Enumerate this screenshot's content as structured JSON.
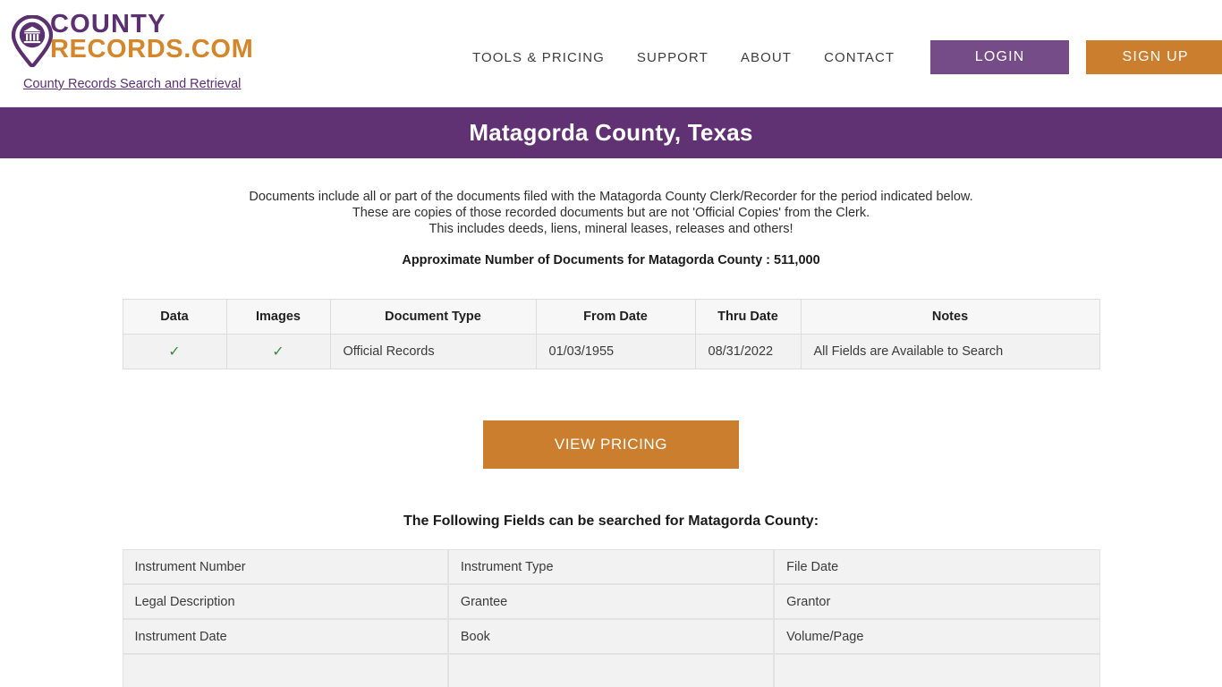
{
  "header": {
    "logo": {
      "icon": "courthouse-map-pin-icon",
      "line1": "COUNTY",
      "line2": "RECORDS.COM",
      "tagline": "County Records Search and Retrieval"
    },
    "nav_links": [
      {
        "label": "TOOLS & PRICING",
        "name": "nav-link-tools-pricing"
      },
      {
        "label": "SUPPORT",
        "name": "nav-link-support"
      },
      {
        "label": "ABOUT",
        "name": "nav-link-about"
      },
      {
        "label": "CONTACT",
        "name": "nav-link-contact"
      }
    ],
    "login_label": "LOGIN",
    "signup_label": "SIGN UP"
  },
  "banner": {
    "title": "Matagorda County, Texas"
  },
  "intro": {
    "line1": "Documents include all or part of the documents filed with the Matagorda County Clerk/Recorder for the period indicated below.",
    "line2": "These are copies of those recorded documents but are not 'Official Copies' from the Clerk.",
    "line3": "This includes deeds, liens, mineral leases, releases and others!",
    "doc_count": "Approximate Number of Documents for Matagorda County : 511,000"
  },
  "coverage_table": {
    "headers": [
      "Data",
      "Images",
      "Document Type",
      "From Date",
      "Thru Date",
      "Notes"
    ],
    "rows": [
      {
        "data": "✓",
        "images": "✓",
        "document_type": "Official Records",
        "from_date": "01/03/1955",
        "thru_date": "08/31/2022",
        "notes": "All Fields are Available to Search"
      }
    ]
  },
  "pricing": {
    "button_label": "VIEW PRICING"
  },
  "fields_section": {
    "heading": "The Following Fields can be searched for Matagorda County:",
    "rows": [
      [
        "Instrument Number",
        "Instrument Type",
        "File Date"
      ],
      [
        "Legal Description",
        "Grantee",
        "Grantor"
      ],
      [
        "Instrument Date",
        "Book",
        "Volume/Page"
      ],
      [
        "",
        "",
        ""
      ]
    ]
  },
  "colors": {
    "brand_purple": "#613273",
    "brand_purple_light": "#754c87",
    "brand_orange": "#ca7e2e",
    "logo_orange": "#d4862a",
    "check_green": "#3f8b3f"
  }
}
